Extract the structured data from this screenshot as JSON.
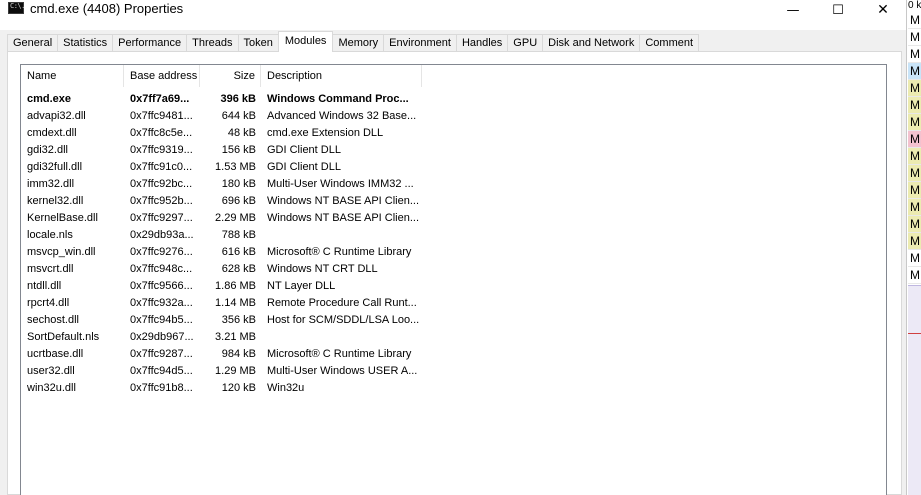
{
  "window": {
    "icon_text": "C:\\.",
    "title": "cmd.exe (4408) Properties",
    "minimize_glyph": "—",
    "maximize_glyph": "☐",
    "close_glyph": "✕"
  },
  "tabs": [
    {
      "label": "General",
      "active": false
    },
    {
      "label": "Statistics",
      "active": false
    },
    {
      "label": "Performance",
      "active": false
    },
    {
      "label": "Threads",
      "active": false
    },
    {
      "label": "Token",
      "active": false
    },
    {
      "label": "Modules",
      "active": true
    },
    {
      "label": "Memory",
      "active": false
    },
    {
      "label": "Environment",
      "active": false
    },
    {
      "label": "Handles",
      "active": false
    },
    {
      "label": "GPU",
      "active": false
    },
    {
      "label": "Disk and Network",
      "active": false
    },
    {
      "label": "Comment",
      "active": false
    }
  ],
  "modules": {
    "columns": [
      "Name",
      "Base address",
      "Size",
      "Description"
    ],
    "rows": [
      {
        "name": "cmd.exe",
        "base": "0x7ff7a69...",
        "size": "396 kB",
        "desc": "Windows Command Proc...",
        "bold": true
      },
      {
        "name": "advapi32.dll",
        "base": "0x7ffc9481...",
        "size": "644 kB",
        "desc": "Advanced Windows 32 Base..."
      },
      {
        "name": "cmdext.dll",
        "base": "0x7ffc8c5e...",
        "size": "48 kB",
        "desc": "cmd.exe Extension DLL"
      },
      {
        "name": "gdi32.dll",
        "base": "0x7ffc9319...",
        "size": "156 kB",
        "desc": "GDI Client DLL"
      },
      {
        "name": "gdi32full.dll",
        "base": "0x7ffc91c0...",
        "size": "1.53 MB",
        "desc": "GDI Client DLL"
      },
      {
        "name": "imm32.dll",
        "base": "0x7ffc92bc...",
        "size": "180 kB",
        "desc": "Multi-User Windows IMM32 ..."
      },
      {
        "name": "kernel32.dll",
        "base": "0x7ffc952b...",
        "size": "696 kB",
        "desc": "Windows NT BASE API Clien..."
      },
      {
        "name": "KernelBase.dll",
        "base": "0x7ffc9297...",
        "size": "2.29 MB",
        "desc": "Windows NT BASE API Clien..."
      },
      {
        "name": "locale.nls",
        "base": "0x29db93a...",
        "size": "788 kB",
        "desc": ""
      },
      {
        "name": "msvcp_win.dll",
        "base": "0x7ffc9276...",
        "size": "616 kB",
        "desc": "Microsoft® C Runtime Library"
      },
      {
        "name": "msvcrt.dll",
        "base": "0x7ffc948c...",
        "size": "628 kB",
        "desc": "Windows NT CRT DLL"
      },
      {
        "name": "ntdll.dll",
        "base": "0x7ffc9566...",
        "size": "1.86 MB",
        "desc": "NT Layer DLL"
      },
      {
        "name": "rpcrt4.dll",
        "base": "0x7ffc932a...",
        "size": "1.14 MB",
        "desc": "Remote Procedure Call Runt..."
      },
      {
        "name": "sechost.dll",
        "base": "0x7ffc94b5...",
        "size": "356 kB",
        "desc": "Host for SCM/SDDL/LSA Loo..."
      },
      {
        "name": "SortDefault.nls",
        "base": "0x29db967...",
        "size": "3.21 MB",
        "desc": ""
      },
      {
        "name": "ucrtbase.dll",
        "base": "0x7ffc9287...",
        "size": "984 kB",
        "desc": "Microsoft® C Runtime Library"
      },
      {
        "name": "user32.dll",
        "base": "0x7ffc94d5...",
        "size": "1.29 MB",
        "desc": "Multi-User Windows USER A..."
      },
      {
        "name": "win32u.dll",
        "base": "0x7ffc91b8...",
        "size": "120 kB",
        "desc": "Win32u"
      }
    ]
  },
  "background_window": {
    "top_text": "0 k",
    "row_letter": "M",
    "row_colors": [
      "#ffffff",
      "#ffffff",
      "#ffffff",
      "#c9e4f8",
      "#ecebb1",
      "#ecebb1",
      "#ecebb1",
      "#f3c2cf",
      "#ecebb1",
      "#ecebb1",
      "#ecebb1",
      "#ecebb1",
      "#ecebb1",
      "#ecebb1",
      "#ffffff",
      "#ffffff"
    ]
  },
  "colors": {
    "dialog_bg": "#f0f0f0",
    "panel_border": "#d9d9d9",
    "list_border": "#828790"
  }
}
